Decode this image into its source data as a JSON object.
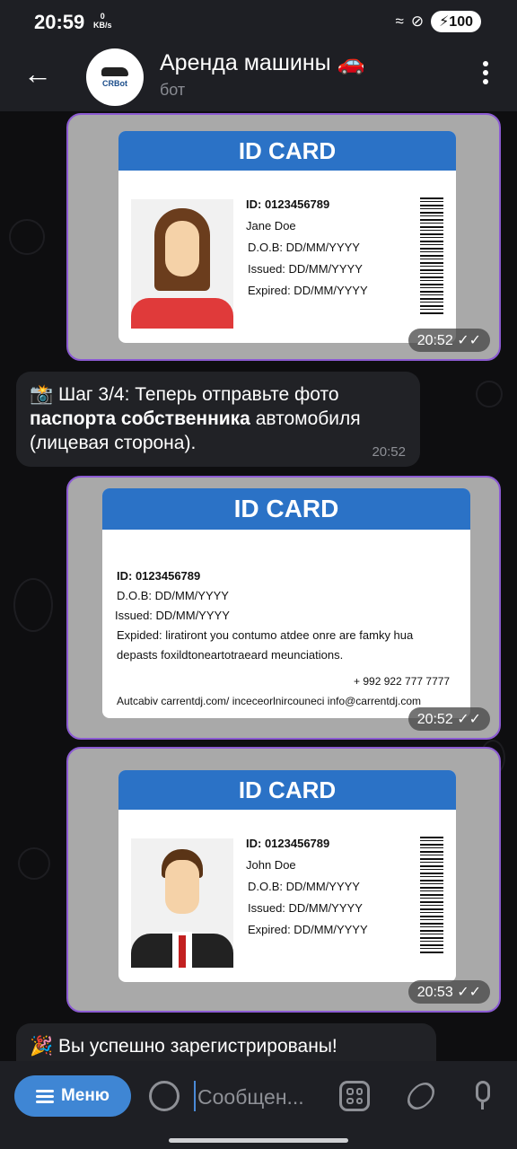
{
  "status_bar": {
    "time": "20:59",
    "speed_value": "0",
    "speed_unit": "KB/s",
    "battery": "100"
  },
  "header": {
    "title": "Аренда машины 🚗",
    "subtitle": "бот",
    "avatar_text": "CRBot"
  },
  "messages": [
    {
      "type": "photo",
      "time": "20:52",
      "card": {
        "heading": "ID CARD",
        "lines": [
          "ID: 0123456789",
          "Jane Doe",
          "D.O.B: DD/MM/YYYY",
          "Issued: DD/MM/YYYY",
          "Expired: DD/MM/YYYY"
        ]
      }
    },
    {
      "type": "text",
      "emoji": "📸",
      "text_before": " Шаг 3/4: Теперь отправьте фото ",
      "text_bold": "паспорта собственника",
      "text_after": " автомобиля (лицевая сторона).",
      "time": "20:52"
    },
    {
      "type": "photo",
      "time": "20:52",
      "card": {
        "heading": "ID CARD",
        "lines": [
          "ID: 0123456789",
          "D.O.B: DD/MM/YYYY",
          "Issued: DD/MM/YYYY",
          "Expided: liratiront you contumo atdee onre are famky hua",
          "depasts foxildtoneartotraeard meunciations.",
          "+ 992 922 777 7777",
          "Autcabiv carrentdj.com/ inceceorlnircouneci info@carrentdj.com"
        ]
      }
    },
    {
      "type": "photo",
      "time": "20:53",
      "card": {
        "heading": "ID CARD",
        "lines": [
          "ID: 0123456789",
          "John Doe",
          "D.O.B: DD/MM/YYYY",
          "Issued: DD/MM/YYYY",
          "Expired: DD/MM/YYYY"
        ]
      }
    },
    {
      "type": "text",
      "emoji": "🎉",
      "text": " Вы успешно зарегистрированы!"
    }
  ],
  "composer": {
    "menu_label": "Меню",
    "placeholder": "Сообщен..."
  },
  "icons": {
    "back": "arrow-left-icon",
    "more": "more-vertical-icon",
    "wifi": "wifi-icon",
    "dnd": "do-not-disturb-icon",
    "read_ticks": "double-check-icon",
    "emoji": "emoji-icon",
    "apps": "apps-icon",
    "attach": "paperclip-icon",
    "mic": "microphone-icon"
  },
  "colors": {
    "accent": "#3f86d4",
    "photo_border": "#8c5bd3",
    "card_header": "#2b72c6"
  }
}
